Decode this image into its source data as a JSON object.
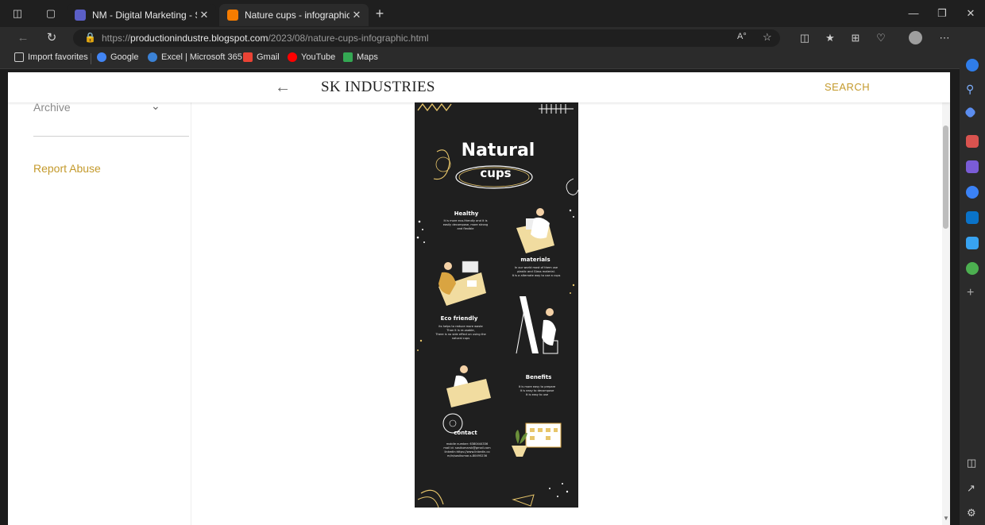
{
  "browser": {
    "tabs": [
      {
        "title": "NM - Digital Marketing - Studen",
        "favicon_color": "#5b5fc7",
        "active": false
      },
      {
        "title": "Nature cups - infographic",
        "favicon_color": "#f57c00",
        "active": true
      }
    ],
    "new_tab_label": "+",
    "url_prefix": "https://",
    "url_host": "productionindustre.blogspot.com",
    "url_path": "/2023/08/nature-cups-infographic.html",
    "read_aloud_label": "A°",
    "bookmarks": [
      {
        "label": "Import favorites",
        "color": "#cfcfcf"
      },
      {
        "label": "Google",
        "color": "#4285f4"
      },
      {
        "label": "Excel | Microsoft 365",
        "color": "#3b82d6"
      },
      {
        "label": "Gmail",
        "color": "#ea4335"
      },
      {
        "label": "YouTube",
        "color": "#ff0000"
      },
      {
        "label": "Maps",
        "color": "#34a853"
      }
    ]
  },
  "site": {
    "brand": "SK INDUSTRIES",
    "search_label": "SEARCH",
    "back_icon": "←",
    "archive_label": "Archive",
    "report_abuse_label": "Report Abuse",
    "accent_color": "#c49a2c"
  },
  "infographic": {
    "title_line1": "Natural",
    "title_line2": "cups",
    "sections": [
      {
        "heading": "Healthy",
        "lines": [
          "It is more eco-friendly and it is",
          "easily decompose, more strong",
          "and flexible"
        ]
      },
      {
        "heading": "materials",
        "lines": [
          "In our world most of them use",
          "plastic and Glass material.",
          "It is a alternate way to use a cups"
        ]
      },
      {
        "heading": "Eco friendly",
        "lines": [
          "its helps to reduce more waste",
          "Than it is re-usable,",
          "There is no side effect on using the",
          "natural cups"
        ]
      },
      {
        "heading": "Benefits",
        "lines": [
          "It is more easy to prepare",
          "It is easy to decompose",
          "It is easy to use"
        ]
      },
      {
        "heading": "contact",
        "lines": [
          "mobile number: 6380444336",
          "mail id: sasikumarsk@gmail.com",
          "linkedin:https://www.linkedin.co",
          "m/in/sasikumar-s-80495236"
        ]
      }
    ]
  }
}
